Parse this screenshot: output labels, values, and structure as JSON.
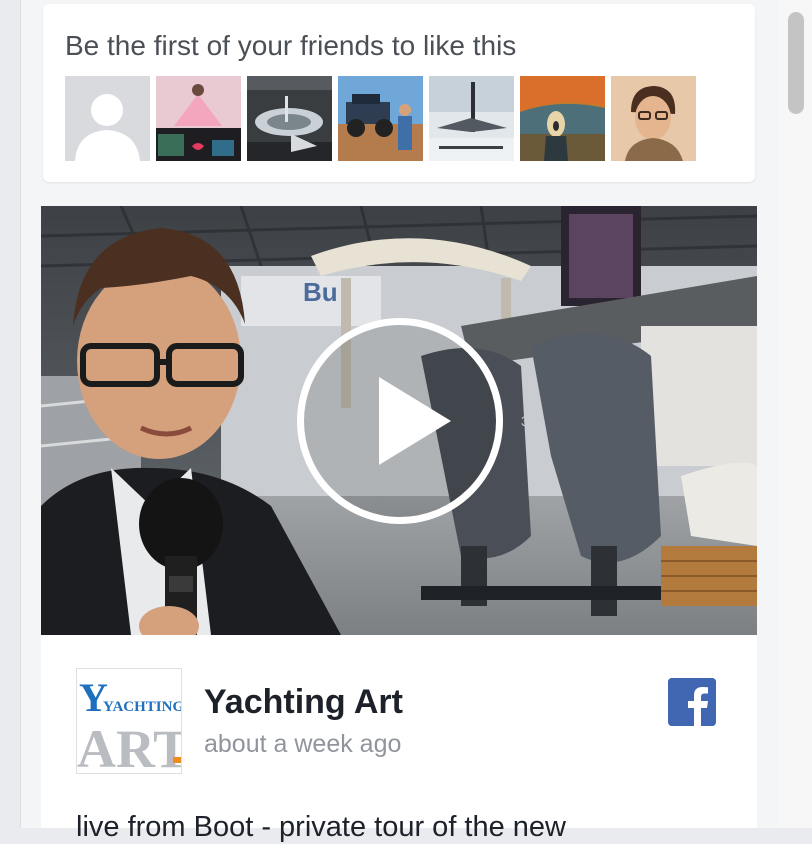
{
  "friends": {
    "text": "Be the first of your friends to like this",
    "avatars": [
      "default-profile",
      "friend-2",
      "friend-3",
      "friend-4",
      "friend-5",
      "friend-6",
      "friend-7"
    ]
  },
  "video": {
    "play_icon": "play-icon"
  },
  "post": {
    "page_name": "Yachting Art",
    "time": "about a week ago",
    "text": "live from Boot - private tour of the new",
    "logo": {
      "line1": "YACHTING",
      "line2": "ART"
    },
    "facebook_icon": "facebook-icon"
  },
  "colors": {
    "facebook_blue": "#4267b2",
    "logo_blue": "#1f6fbf",
    "logo_grey": "#b9bcc0",
    "logo_orange": "#f28b1e"
  }
}
